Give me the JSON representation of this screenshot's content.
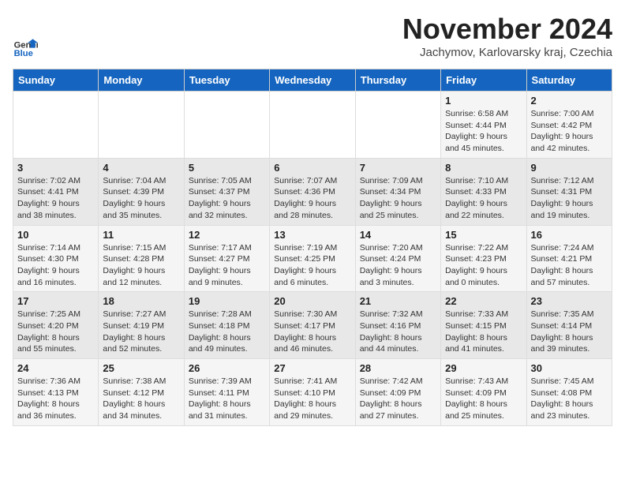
{
  "logo": {
    "line1": "General",
    "line2": "Blue"
  },
  "title": "November 2024",
  "location": "Jachymov, Karlovarsky kraj, Czechia",
  "days_header": [
    "Sunday",
    "Monday",
    "Tuesday",
    "Wednesday",
    "Thursday",
    "Friday",
    "Saturday"
  ],
  "weeks": [
    [
      {
        "day": "",
        "info": ""
      },
      {
        "day": "",
        "info": ""
      },
      {
        "day": "",
        "info": ""
      },
      {
        "day": "",
        "info": ""
      },
      {
        "day": "",
        "info": ""
      },
      {
        "day": "1",
        "info": "Sunrise: 6:58 AM\nSunset: 4:44 PM\nDaylight: 9 hours\nand 45 minutes."
      },
      {
        "day": "2",
        "info": "Sunrise: 7:00 AM\nSunset: 4:42 PM\nDaylight: 9 hours\nand 42 minutes."
      }
    ],
    [
      {
        "day": "3",
        "info": "Sunrise: 7:02 AM\nSunset: 4:41 PM\nDaylight: 9 hours\nand 38 minutes."
      },
      {
        "day": "4",
        "info": "Sunrise: 7:04 AM\nSunset: 4:39 PM\nDaylight: 9 hours\nand 35 minutes."
      },
      {
        "day": "5",
        "info": "Sunrise: 7:05 AM\nSunset: 4:37 PM\nDaylight: 9 hours\nand 32 minutes."
      },
      {
        "day": "6",
        "info": "Sunrise: 7:07 AM\nSunset: 4:36 PM\nDaylight: 9 hours\nand 28 minutes."
      },
      {
        "day": "7",
        "info": "Sunrise: 7:09 AM\nSunset: 4:34 PM\nDaylight: 9 hours\nand 25 minutes."
      },
      {
        "day": "8",
        "info": "Sunrise: 7:10 AM\nSunset: 4:33 PM\nDaylight: 9 hours\nand 22 minutes."
      },
      {
        "day": "9",
        "info": "Sunrise: 7:12 AM\nSunset: 4:31 PM\nDaylight: 9 hours\nand 19 minutes."
      }
    ],
    [
      {
        "day": "10",
        "info": "Sunrise: 7:14 AM\nSunset: 4:30 PM\nDaylight: 9 hours\nand 16 minutes."
      },
      {
        "day": "11",
        "info": "Sunrise: 7:15 AM\nSunset: 4:28 PM\nDaylight: 9 hours\nand 12 minutes."
      },
      {
        "day": "12",
        "info": "Sunrise: 7:17 AM\nSunset: 4:27 PM\nDaylight: 9 hours\nand 9 minutes."
      },
      {
        "day": "13",
        "info": "Sunrise: 7:19 AM\nSunset: 4:25 PM\nDaylight: 9 hours\nand 6 minutes."
      },
      {
        "day": "14",
        "info": "Sunrise: 7:20 AM\nSunset: 4:24 PM\nDaylight: 9 hours\nand 3 minutes."
      },
      {
        "day": "15",
        "info": "Sunrise: 7:22 AM\nSunset: 4:23 PM\nDaylight: 9 hours\nand 0 minutes."
      },
      {
        "day": "16",
        "info": "Sunrise: 7:24 AM\nSunset: 4:21 PM\nDaylight: 8 hours\nand 57 minutes."
      }
    ],
    [
      {
        "day": "17",
        "info": "Sunrise: 7:25 AM\nSunset: 4:20 PM\nDaylight: 8 hours\nand 55 minutes."
      },
      {
        "day": "18",
        "info": "Sunrise: 7:27 AM\nSunset: 4:19 PM\nDaylight: 8 hours\nand 52 minutes."
      },
      {
        "day": "19",
        "info": "Sunrise: 7:28 AM\nSunset: 4:18 PM\nDaylight: 8 hours\nand 49 minutes."
      },
      {
        "day": "20",
        "info": "Sunrise: 7:30 AM\nSunset: 4:17 PM\nDaylight: 8 hours\nand 46 minutes."
      },
      {
        "day": "21",
        "info": "Sunrise: 7:32 AM\nSunset: 4:16 PM\nDaylight: 8 hours\nand 44 minutes."
      },
      {
        "day": "22",
        "info": "Sunrise: 7:33 AM\nSunset: 4:15 PM\nDaylight: 8 hours\nand 41 minutes."
      },
      {
        "day": "23",
        "info": "Sunrise: 7:35 AM\nSunset: 4:14 PM\nDaylight: 8 hours\nand 39 minutes."
      }
    ],
    [
      {
        "day": "24",
        "info": "Sunrise: 7:36 AM\nSunset: 4:13 PM\nDaylight: 8 hours\nand 36 minutes."
      },
      {
        "day": "25",
        "info": "Sunrise: 7:38 AM\nSunset: 4:12 PM\nDaylight: 8 hours\nand 34 minutes."
      },
      {
        "day": "26",
        "info": "Sunrise: 7:39 AM\nSunset: 4:11 PM\nDaylight: 8 hours\nand 31 minutes."
      },
      {
        "day": "27",
        "info": "Sunrise: 7:41 AM\nSunset: 4:10 PM\nDaylight: 8 hours\nand 29 minutes."
      },
      {
        "day": "28",
        "info": "Sunrise: 7:42 AM\nSunset: 4:09 PM\nDaylight: 8 hours\nand 27 minutes."
      },
      {
        "day": "29",
        "info": "Sunrise: 7:43 AM\nSunset: 4:09 PM\nDaylight: 8 hours\nand 25 minutes."
      },
      {
        "day": "30",
        "info": "Sunrise: 7:45 AM\nSunset: 4:08 PM\nDaylight: 8 hours\nand 23 minutes."
      }
    ]
  ]
}
